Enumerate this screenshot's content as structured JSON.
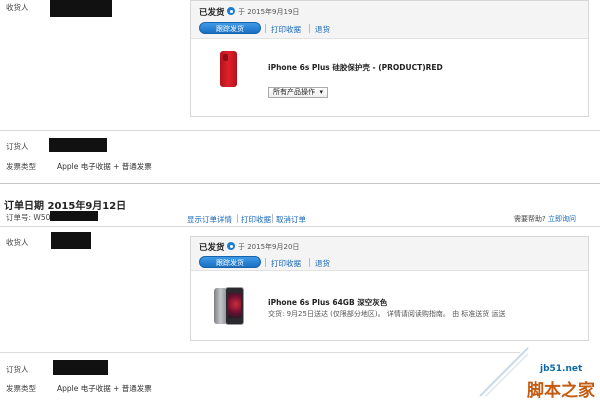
{
  "order1": {
    "recipient_label": "收货人",
    "shipment": {
      "status": "已发货",
      "date": "于 2015年9月19日",
      "track_button": "跟踪发货",
      "print_receipt": "打印收据",
      "return": "退货",
      "product_name": "iPhone 6s Plus 硅胶保护壳 - (PRODUCT)RED",
      "product_actions": "所有产品操作"
    },
    "orderer_label": "订货人",
    "invoice_label": "发票类型",
    "invoice_value": "Apple 电子收据 + 普通发票"
  },
  "order2": {
    "order_date": "订单日期 2015年9月12日",
    "order_number_label": "订单号: W50",
    "view_details": "显示订单详情",
    "print_receipt": "打印收据",
    "cancel_order": "取消订单",
    "help_prefix": "需要帮助?",
    "help_link": "立即询问",
    "recipient_label": "收货人",
    "shipment": {
      "status": "已发货",
      "date": "于 2015年9月20日",
      "track_button": "跟踪发货",
      "print_receipt": "打印收据",
      "return": "退货",
      "product_name": "iPhone 6s Plus 64GB 深空灰色",
      "product_detail": "交货: 9月25日送达 (仅限部分地区)。 详情请阅读购指南。 由 标准送货 运送"
    },
    "orderer_label": "订货人",
    "invoice_label": "发票类型",
    "invoice_value": "Apple 电子收据 + 普通发票"
  },
  "watermark": {
    "site": "jb51.net",
    "name": "脚本之家"
  },
  "colors": {
    "link": "#1566b8",
    "button": "#1b6fc1",
    "status_dot": "#1a7ed1",
    "watermark_orange": "#c45b12"
  }
}
